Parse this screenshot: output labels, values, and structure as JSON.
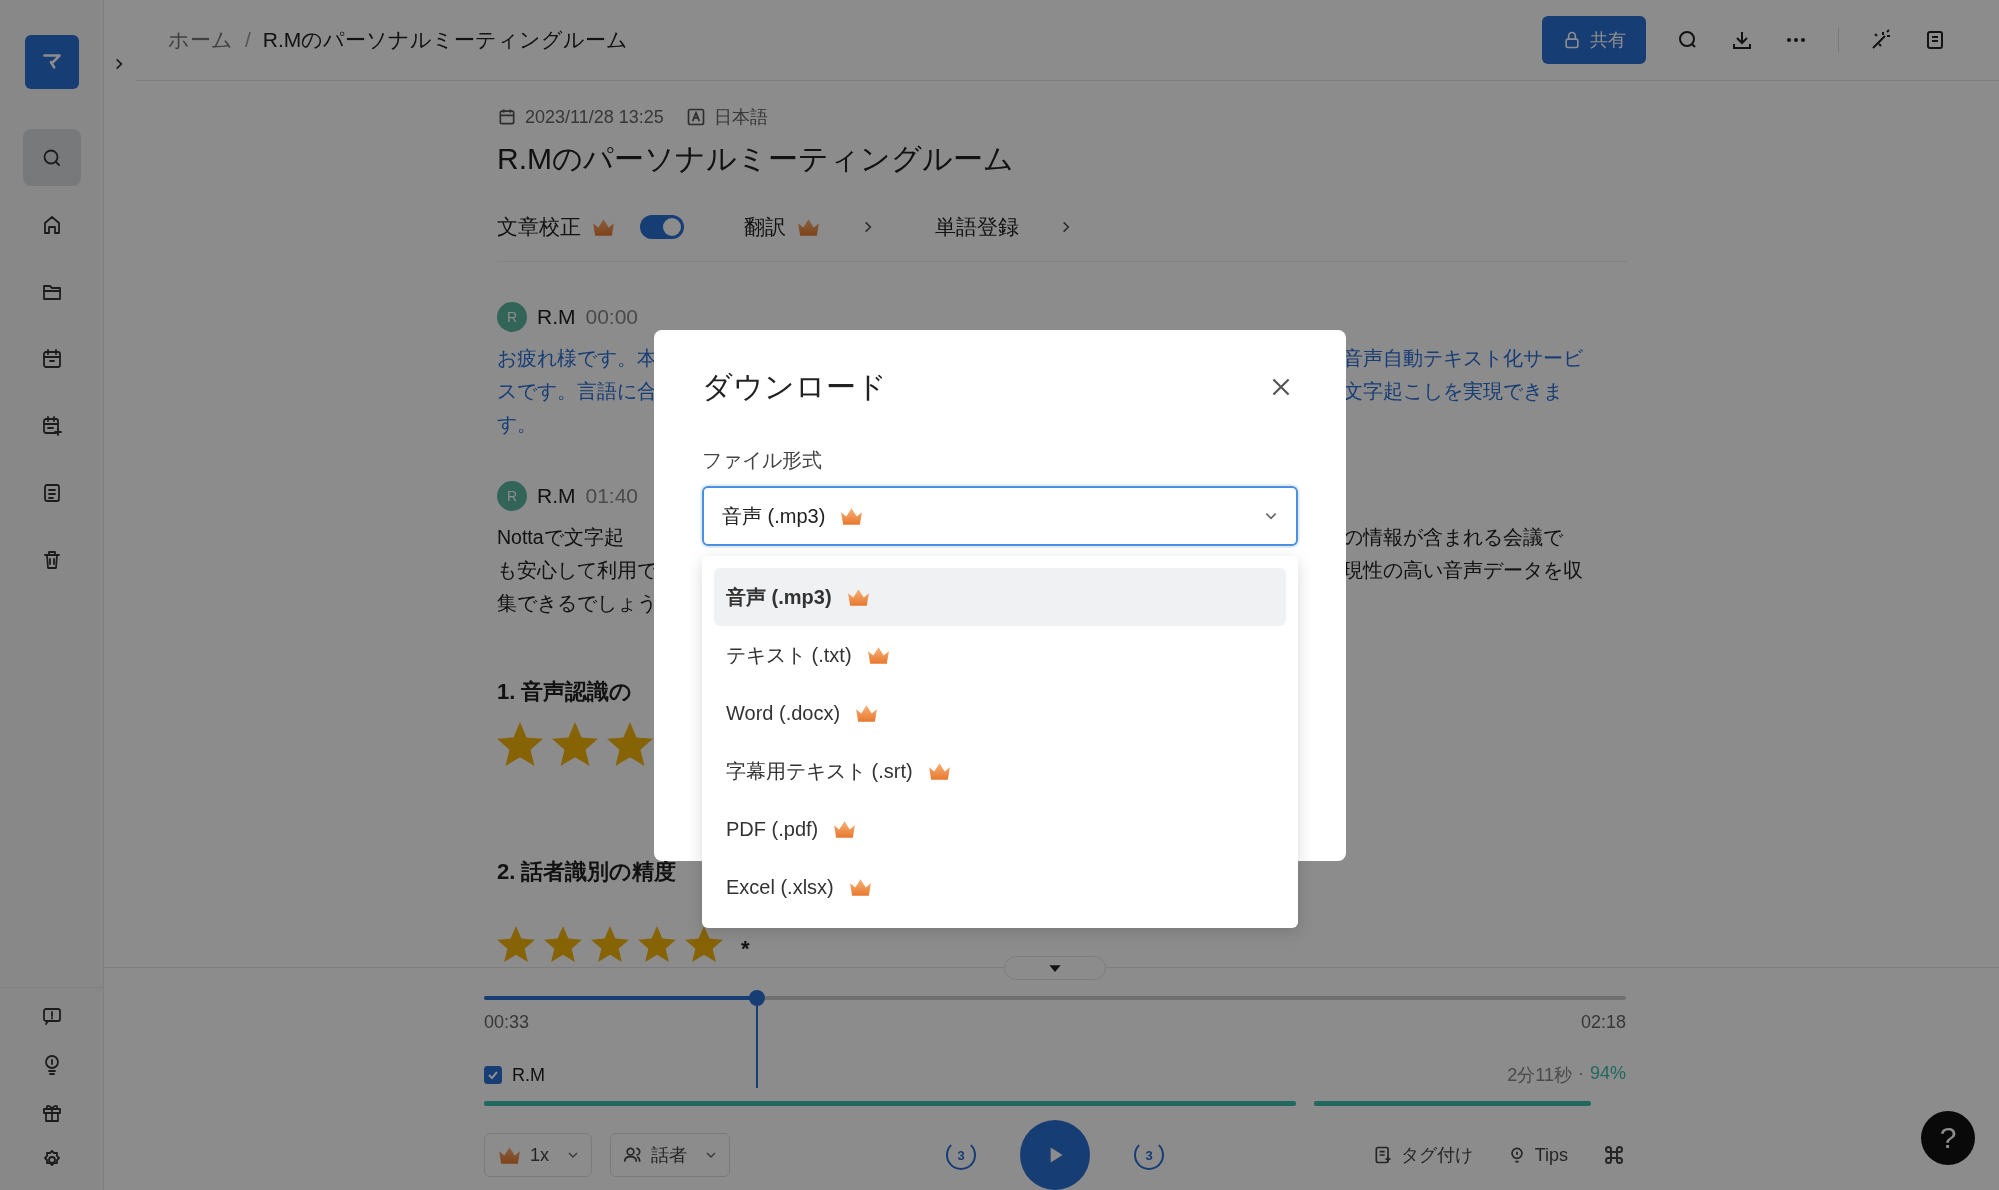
{
  "sidebar": {
    "items": [
      {
        "kind": "search",
        "selected": true
      },
      {
        "kind": "home",
        "selected": false
      },
      {
        "kind": "folder",
        "selected": false
      },
      {
        "kind": "calendar",
        "selected": false
      },
      {
        "kind": "calendar-add",
        "selected": false
      },
      {
        "kind": "notes",
        "selected": false
      },
      {
        "kind": "trash",
        "selected": false
      }
    ],
    "bottom_items": [
      {
        "kind": "feedback"
      },
      {
        "kind": "bulb"
      },
      {
        "kind": "gift"
      },
      {
        "kind": "settings"
      }
    ]
  },
  "breadcrumb": {
    "items": [
      "ホーム",
      "R.Mのパーソナルミーティングルーム"
    ],
    "separator": "/"
  },
  "header": {
    "share_label": "共有"
  },
  "meta": {
    "date": "2023/11/28 13:25",
    "language": "日本語"
  },
  "title": "R.Mのパーソナルミーティングルーム",
  "toolbar": [
    {
      "kind": "toggle",
      "label": "文章校正",
      "premium": true,
      "on": true
    },
    {
      "kind": "link",
      "label": "翻訳",
      "premium": true
    },
    {
      "kind": "link",
      "label": "単語登録",
      "premium": false
    }
  ],
  "transcript": [
    {
      "speaker": "R.M",
      "avatar": "R",
      "time": "00:00",
      "highlighted": true,
      "left_lines": [
        "お疲れ様です。本",
        "スです。言語に合",
        "す。"
      ],
      "right_lines": [
        "音声自動テキスト化サービ",
        "文字起こしを実現できま"
      ]
    },
    {
      "speaker": "R.M",
      "avatar": "R",
      "time": "01:40",
      "highlighted": false,
      "left_lines": [
        "Nottaで文字起",
        "も安心して利用で",
        "集できるでしょう"
      ],
      "right_lines": [
        "の情報が含まれる会議で",
        "現性の高い音声データを収"
      ]
    }
  ],
  "sections": [
    {
      "heading": "1. 音声認識の",
      "stars": 3
    },
    {
      "heading": "2. 話者識別の精度",
      "stars": 5,
      "note": "*"
    }
  ],
  "player": {
    "level": 0.239,
    "current": "00:33",
    "total": "02:18",
    "speaker": {
      "name": "R.M",
      "checked": true
    },
    "duration": "2分11秒",
    "separator": "·",
    "percent": "94%",
    "speed": "1x",
    "speaker_filter": "話者",
    "rewind": "3",
    "forward": "3",
    "tag_label": "タグ付け",
    "tips_label": "Tips"
  },
  "dialog": {
    "title": "ダウンロード",
    "field_label": "ファイル形式",
    "value": "音声 (.mp3)",
    "value_premium": true,
    "options": [
      {
        "label": "音声 (.mp3)",
        "premium": true,
        "selected": true
      },
      {
        "label": "テキスト (.txt)",
        "premium": true,
        "selected": false
      },
      {
        "label": "Word (.docx)",
        "premium": true,
        "selected": false
      },
      {
        "label": "字幕用テキスト (.srt)",
        "premium": true,
        "selected": false
      },
      {
        "label": "PDF (.pdf)",
        "premium": true,
        "selected": false
      },
      {
        "label": "Excel (.xlsx)",
        "premium": true,
        "selected": false
      }
    ]
  },
  "help_label": "?"
}
